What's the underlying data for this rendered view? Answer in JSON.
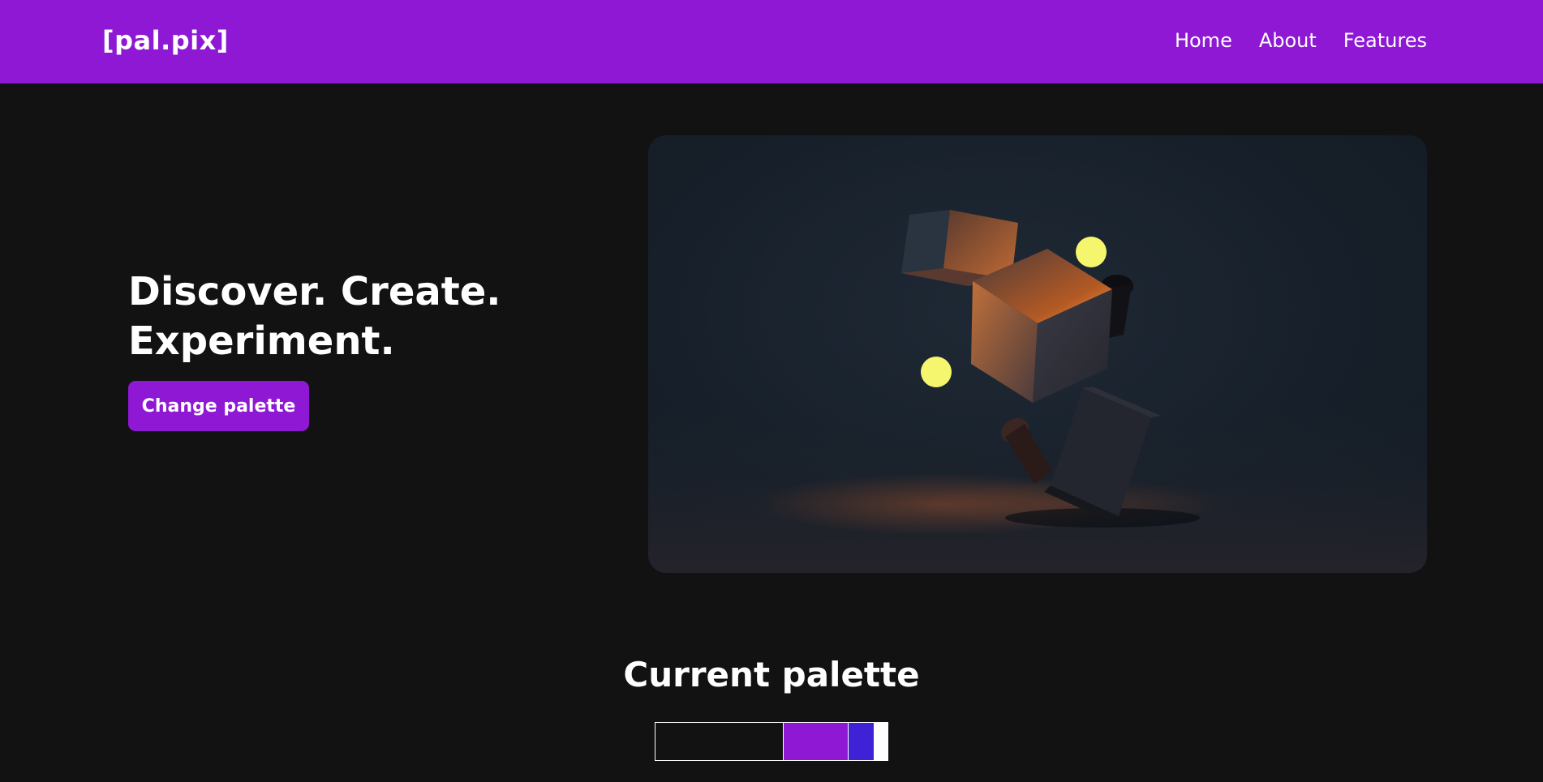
{
  "navbar": {
    "brand": "[pal.pix]",
    "links": [
      {
        "label": "Home"
      },
      {
        "label": "About"
      },
      {
        "label": "Features"
      }
    ],
    "background_color": "#8e18d4"
  },
  "hero": {
    "title_line_1": "Discover. Create.",
    "title_line_2": "Experiment.",
    "cta_label": "Change palette"
  },
  "palette": {
    "title": "Current palette",
    "colors": [
      "#121212",
      "#8e18d4",
      "#3f22d6",
      "#ffffff"
    ]
  }
}
